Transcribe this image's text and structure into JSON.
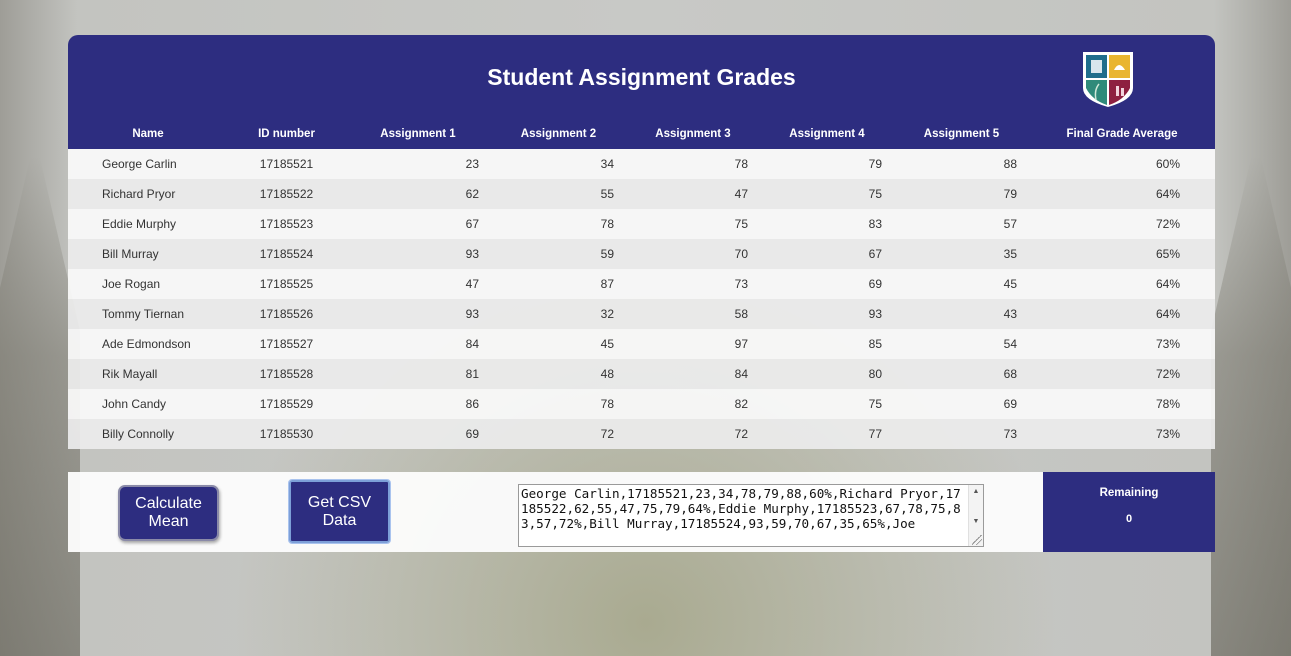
{
  "header": {
    "title": "Student Assignment Grades"
  },
  "table": {
    "columns": [
      "Name",
      "ID number",
      "Assignment 1",
      "Assignment 2",
      "Assignment 3",
      "Assignment 4",
      "Assignment 5",
      "Final Grade Average"
    ],
    "rows": [
      [
        "George Carlin",
        "17185521",
        "23",
        "34",
        "78",
        "79",
        "88",
        "60%"
      ],
      [
        "Richard Pryor",
        "17185522",
        "62",
        "55",
        "47",
        "75",
        "79",
        "64%"
      ],
      [
        "Eddie Murphy",
        "17185523",
        "67",
        "78",
        "75",
        "83",
        "57",
        "72%"
      ],
      [
        "Bill Murray",
        "17185524",
        "93",
        "59",
        "70",
        "67",
        "35",
        "65%"
      ],
      [
        "Joe Rogan",
        "17185525",
        "47",
        "87",
        "73",
        "69",
        "45",
        "64%"
      ],
      [
        "Tommy Tiernan",
        "17185526",
        "93",
        "32",
        "58",
        "93",
        "43",
        "64%"
      ],
      [
        "Ade Edmondson",
        "17185527",
        "84",
        "45",
        "97",
        "85",
        "54",
        "73%"
      ],
      [
        "Rik Mayall",
        "17185528",
        "81",
        "48",
        "84",
        "80",
        "68",
        "72%"
      ],
      [
        "John Candy",
        "17185529",
        "86",
        "78",
        "82",
        "75",
        "69",
        "78%"
      ],
      [
        "Billy Connolly",
        "17185530",
        "69",
        "72",
        "72",
        "77",
        "73",
        "73%"
      ]
    ]
  },
  "controls": {
    "calculate_mean_label": "Calculate Mean",
    "get_csv_label": "Get CSV Data",
    "csv_text": "George Carlin,17185521,23,34,78,79,88,60%,Richard Pryor,17185522,62,55,47,75,79,64%,Eddie Murphy,17185523,67,78,75,83,57,72%,Bill Murray,17185524,93,59,70,67,35,65%,Joe",
    "remaining_label": "Remaining",
    "remaining_value": "0"
  },
  "icons": {
    "crest": "university-crest-icon",
    "scroll_up": "scroll-up-arrow-icon",
    "scroll_down": "scroll-down-arrow-icon"
  },
  "colors": {
    "primary": "#2d2d80",
    "row_light": "#fafafa",
    "row_dark": "#ececec"
  }
}
